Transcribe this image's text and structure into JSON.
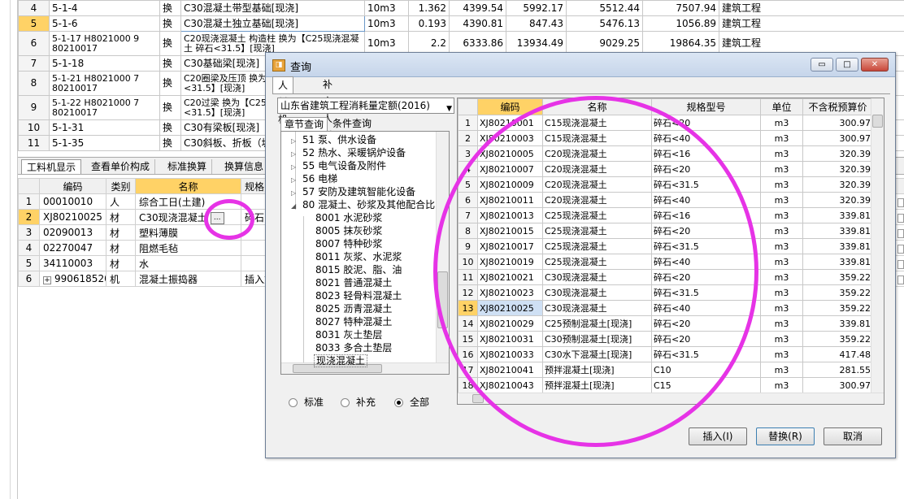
{
  "top_table": {
    "rows": [
      {
        "no": "4",
        "code": "5-1-4",
        "kind": "换",
        "name": "C30混凝土带型基础[现浇]",
        "unit": "10m3",
        "qty": "1.362",
        "price": "4399.54",
        "total": "5992.17",
        "unit_price": "5512.44",
        "amount": "7507.94",
        "type": "建筑工程"
      },
      {
        "no": "5",
        "code": "5-1-6",
        "kind": "换",
        "name": "C30混凝土独立基础[现浇]",
        "unit": "10m3",
        "qty": "0.193",
        "price": "4390.81",
        "total": "847.43",
        "unit_price": "5476.13",
        "amount": "1056.89",
        "type": "建筑工程"
      },
      {
        "no": "6",
        "code": "5-1-17 H8021000 9 80210017",
        "kind": "换",
        "name": "C20现浇混凝土 构造柱 换为【C25现浇混凝土 碎石<31.5】[现浇]",
        "unit": "10m3",
        "qty": "2.2",
        "price": "6333.86",
        "total": "13934.49",
        "unit_price": "9029.25",
        "amount": "19864.35",
        "type": "建筑工程"
      },
      {
        "no": "7",
        "code": "5-1-18",
        "kind": "换",
        "name": "C30基础梁[现浇]",
        "unit": "",
        "qty": "",
        "price": "",
        "total": "",
        "unit_price": "",
        "amount": "",
        "type": ""
      },
      {
        "no": "8",
        "code": "5-1-21 H8021000 7 80210017",
        "kind": "换",
        "name": "C20圈梁及压顶 换为【C25现浇混凝土 碎石<31.5】[现浇]",
        "unit": "",
        "qty": "",
        "price": "",
        "total": "",
        "unit_price": "",
        "amount": "",
        "type": ""
      },
      {
        "no": "9",
        "code": "5-1-22 H8021000 7 80210017",
        "kind": "换",
        "name": "C20过梁 换为【C25现浇混凝土 碎石<31.5】[现浇]",
        "unit": "",
        "qty": "",
        "price": "",
        "total": "",
        "unit_price": "",
        "amount": "",
        "type": ""
      },
      {
        "no": "10",
        "code": "5-1-31",
        "kind": "换",
        "name": "C30有梁板[现浇]",
        "unit": "",
        "qty": "",
        "price": "",
        "total": "",
        "unit_price": "",
        "amount": "",
        "type": ""
      },
      {
        "no": "11",
        "code": "5-1-35",
        "kind": "换",
        "name": "C30斜板、折板（坡",
        "unit": "",
        "qty": "",
        "price": "",
        "total": "",
        "unit_price": "",
        "amount": "",
        "type": ""
      }
    ]
  },
  "bottom_tabs": [
    "工料机显示",
    "查看单价构成",
    "标准换算",
    "换算信息"
  ],
  "bottom_table": {
    "headers": [
      "",
      "编码",
      "类别",
      "名称",
      "规格"
    ],
    "rows": [
      {
        "no": "1",
        "code": "00010010",
        "cat": "人",
        "name": "综合工日(土建)",
        "spec": ""
      },
      {
        "no": "2",
        "code": "XJ80210025",
        "cat": "材",
        "name": "C30现浇混凝土",
        "spec": "碎石"
      },
      {
        "no": "3",
        "code": "02090013",
        "cat": "材",
        "name": "塑料薄膜",
        "spec": ""
      },
      {
        "no": "4",
        "code": "02270047",
        "cat": "材",
        "name": "阻燃毛毡",
        "spec": ""
      },
      {
        "no": "5",
        "code": "34110003",
        "cat": "材",
        "name": "水",
        "spec": ""
      },
      {
        "no": "6",
        "code": "990618520",
        "cat": "机",
        "name": "混凝土振捣器",
        "spec": "插入式"
      }
    ],
    "ellipsis": "...",
    "expand_glyph": "+"
  },
  "dialog": {
    "title": "查询",
    "icon": "query-app-icon",
    "min_label": "▭",
    "max_label": "□",
    "close_label": "✕",
    "tabs": [
      "人材机",
      "补充人材机"
    ],
    "quota_select": "山东省建筑工程消耗量定额(2016)",
    "subtabs": [
      "章节查询",
      "条件查询"
    ],
    "tree": [
      {
        "label": "51 泵、供水设备",
        "level": 1,
        "twisty": "▷"
      },
      {
        "label": "52 热水、采暖锅炉设备",
        "level": 1,
        "twisty": "▷"
      },
      {
        "label": "55 电气设备及附件",
        "level": 1,
        "twisty": "▷"
      },
      {
        "label": "56 电梯",
        "level": 1,
        "twisty": "▷"
      },
      {
        "label": "57 安防及建筑智能化设备",
        "level": 1,
        "twisty": "▷"
      },
      {
        "label": "80 混凝土、砂浆及其他配合比",
        "level": 1,
        "twisty": "◢"
      },
      {
        "label": "8001 水泥砂浆",
        "level": 2,
        "twisty": ""
      },
      {
        "label": "8005 抹灰砂浆",
        "level": 2,
        "twisty": ""
      },
      {
        "label": "8007 特种砂浆",
        "level": 2,
        "twisty": ""
      },
      {
        "label": "8011 灰浆、水泥浆",
        "level": 2,
        "twisty": ""
      },
      {
        "label": "8015 胶泥、脂、油",
        "level": 2,
        "twisty": ""
      },
      {
        "label": "8021 普通混凝土",
        "level": 2,
        "twisty": ""
      },
      {
        "label": "8023 轻骨料混凝土",
        "level": 2,
        "twisty": ""
      },
      {
        "label": "8025 沥青混凝土",
        "level": 2,
        "twisty": ""
      },
      {
        "label": "8027 特种混凝土",
        "level": 2,
        "twisty": ""
      },
      {
        "label": "8031 灰土垫层",
        "level": 2,
        "twisty": ""
      },
      {
        "label": "8033 多合土垫层",
        "level": 2,
        "twisty": ""
      },
      {
        "label": "现浇混凝土",
        "level": 3,
        "twisty": ""
      }
    ],
    "radios": [
      {
        "label": "标准",
        "checked": false
      },
      {
        "label": "补充",
        "checked": false
      },
      {
        "label": "全部",
        "checked": true
      }
    ],
    "grid_headers": [
      "",
      "编码",
      "名称",
      "规格型号",
      "单位",
      "不含税预算价"
    ],
    "grid_rows": [
      {
        "no": "1",
        "code": "XJ80210001",
        "name": "C15现浇混凝土",
        "spec": "碎石<20",
        "unit": "m3",
        "price": "300.97"
      },
      {
        "no": "2",
        "code": "XJ80210003",
        "name": "C15现浇混凝土",
        "spec": "碎石<40",
        "unit": "m3",
        "price": "300.97"
      },
      {
        "no": "3",
        "code": "XJ80210005",
        "name": "C20现浇混凝土",
        "spec": "碎石<16",
        "unit": "m3",
        "price": "320.39"
      },
      {
        "no": "4",
        "code": "XJ80210007",
        "name": "C20现浇混凝土",
        "spec": "碎石<20",
        "unit": "m3",
        "price": "320.39"
      },
      {
        "no": "5",
        "code": "XJ80210009",
        "name": "C20现浇混凝土",
        "spec": "碎石<31.5",
        "unit": "m3",
        "price": "320.39"
      },
      {
        "no": "6",
        "code": "XJ80210011",
        "name": "C20现浇混凝土",
        "spec": "碎石<40",
        "unit": "m3",
        "price": "320.39"
      },
      {
        "no": "7",
        "code": "XJ80210013",
        "name": "C25现浇混凝土",
        "spec": "碎石<16",
        "unit": "m3",
        "price": "339.81"
      },
      {
        "no": "8",
        "code": "XJ80210015",
        "name": "C25现浇混凝土",
        "spec": "碎石<20",
        "unit": "m3",
        "price": "339.81"
      },
      {
        "no": "9",
        "code": "XJ80210017",
        "name": "C25现浇混凝土",
        "spec": "碎石<31.5",
        "unit": "m3",
        "price": "339.81"
      },
      {
        "no": "10",
        "code": "XJ80210019",
        "name": "C25现浇混凝土",
        "spec": "碎石<40",
        "unit": "m3",
        "price": "339.81"
      },
      {
        "no": "11",
        "code": "XJ80210021",
        "name": "C30现浇混凝土",
        "spec": "碎石<20",
        "unit": "m3",
        "price": "359.22"
      },
      {
        "no": "12",
        "code": "XJ80210023",
        "name": "C30现浇混凝土",
        "spec": "碎石<31.5",
        "unit": "m3",
        "price": "359.22"
      },
      {
        "no": "13",
        "code": "XJ80210025",
        "name": "C30现浇混凝土",
        "spec": "碎石<40",
        "unit": "m3",
        "price": "359.22"
      },
      {
        "no": "14",
        "code": "XJ80210029",
        "name": "C25预制混凝土[现浇]",
        "spec": "碎石<20",
        "unit": "m3",
        "price": "339.81"
      },
      {
        "no": "15",
        "code": "XJ80210031",
        "name": "C30预制混凝土[现浇]",
        "spec": "碎石<20",
        "unit": "m3",
        "price": "359.22"
      },
      {
        "no": "16",
        "code": "XJ80210033",
        "name": "C30水下混凝土[现浇]",
        "spec": "碎石<31.5",
        "unit": "m3",
        "price": "417.48"
      },
      {
        "no": "17",
        "code": "XJ80210041",
        "name": "预拌混凝土[现浇]",
        "spec": "C10",
        "unit": "m3",
        "price": "281.55"
      },
      {
        "no": "18",
        "code": "XJ80210043",
        "name": "预拌混凝土[现浇]",
        "spec": "C15",
        "unit": "m3",
        "price": "300.97"
      },
      {
        "no": "19",
        "code": "XJ80210045",
        "name": "预拌混凝土[现浇]",
        "spec": "C15(预制)",
        "unit": "m3",
        "price": "300.97"
      }
    ],
    "buttons": {
      "insert": "插入(I)",
      "replace": "替换(R)",
      "cancel": "取消"
    }
  },
  "colors": {
    "highlight": "#ffd266",
    "annotation": "#e633e6",
    "selection": "#cfe0f4"
  }
}
